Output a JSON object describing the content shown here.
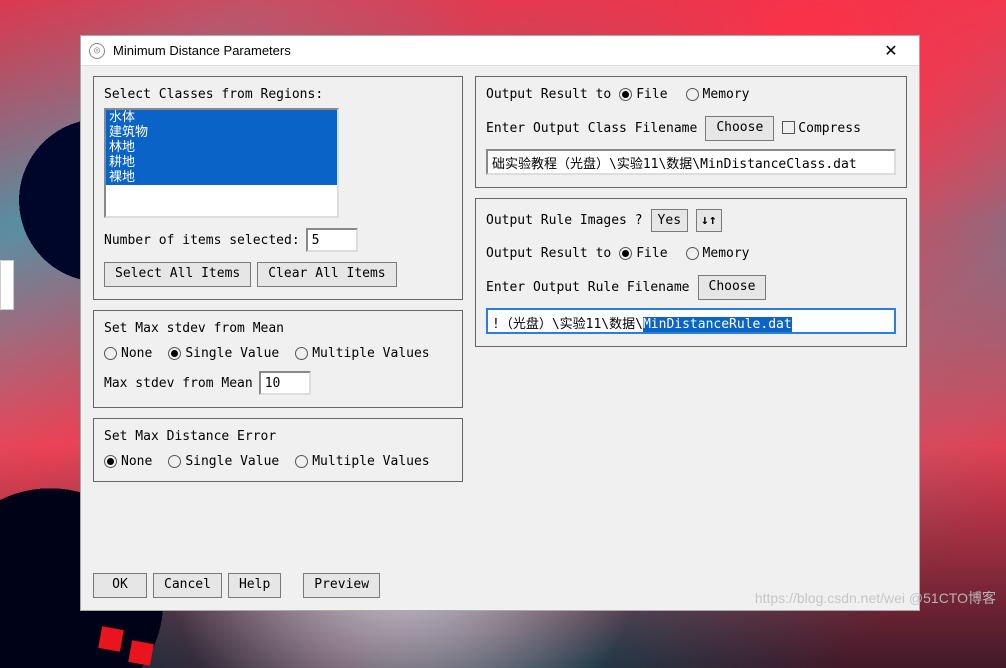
{
  "window": {
    "title": "Minimum Distance Parameters"
  },
  "classes": {
    "label": "Select Classes from Regions:",
    "items": [
      "水体",
      "建筑物",
      "林地",
      "耕地",
      "裸地"
    ],
    "selected_count_label": "Number of items selected:",
    "selected_count": "5",
    "select_all": "Select All Items",
    "clear_all": "Clear All Items"
  },
  "stdev": {
    "title": "Set Max stdev from Mean",
    "none": "None",
    "single": "Single Value",
    "multiple": "Multiple Values",
    "value_label": "Max stdev from Mean",
    "value": "10"
  },
  "dist": {
    "title": "Set Max Distance Error",
    "none": "None",
    "single": "Single Value",
    "multiple": "Multiple Values"
  },
  "out_class": {
    "result_label": "Output Result to",
    "file": "File",
    "memory": "Memory",
    "enter_label": "Enter Output Class Filename",
    "choose": "Choose",
    "compress": "Compress",
    "path": "础实验教程（光盘）\\实验11\\数据\\MinDistanceClass.dat"
  },
  "out_rule": {
    "q_label": "Output Rule Images ?",
    "yes": "Yes",
    "swap": "↓↑",
    "result_label": "Output Result to",
    "file": "File",
    "memory": "Memory",
    "enter_label": "Enter Output Rule Filename",
    "choose": "Choose",
    "path_prefix": "!（光盘）\\实验11\\数据\\",
    "path_sel": "MinDistanceRule.dat"
  },
  "buttons": {
    "ok": "OK",
    "cancel": "Cancel",
    "help": "Help",
    "preview": "Preview"
  },
  "watermark": "https://blog.csdn.net/wei @51CTO博客"
}
